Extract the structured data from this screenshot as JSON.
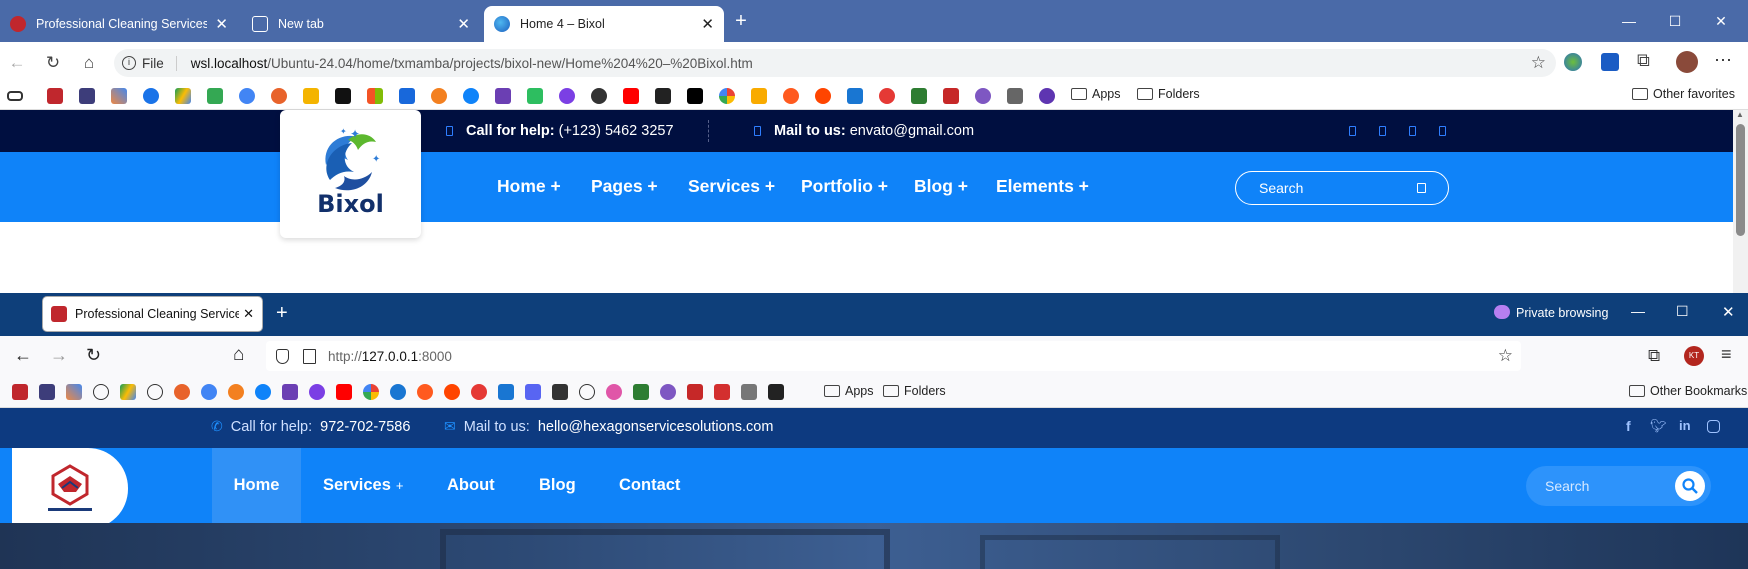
{
  "edge": {
    "tabs": [
      {
        "title": "Professional Cleaning Services - Y",
        "favicon_color": "#c0272d"
      },
      {
        "title": "New tab",
        "favicon_color": "#ffffff"
      },
      {
        "title": "Home 4 – Bixol",
        "favicon_color": "#3a8bd8"
      }
    ],
    "address": {
      "scheme_label": "File",
      "url_host": "wsl.localhost",
      "url_path": "/Ubuntu-24.04/home/txmamba/projects/bixol-new/Home%204%20–%20Bixol.htm"
    },
    "bookmarks": {
      "apps_label": "Apps",
      "folders_label": "Folders",
      "other_label": "Other favorites"
    }
  },
  "bixol": {
    "topbar": {
      "call_label": "Call for help:",
      "call_value": "(+123) 5462 3257",
      "mail_label": "Mail to us:",
      "mail_value": "envato@gmail.com"
    },
    "logo_text": "Bixol",
    "menu": [
      "Home +",
      "Pages +",
      "Services +",
      "Portfolio +",
      "Blog +",
      "Elements +"
    ],
    "search_placeholder": "Search"
  },
  "firefox": {
    "tab_title": "Professional Cleaning Services - Y",
    "private_label": "Private browsing",
    "address": {
      "url_prefix": "http://",
      "url_host": "127.0.0.1",
      "url_port": ":8000"
    },
    "bookmarks": {
      "apps_label": "Apps",
      "folders_label": "Folders",
      "other_label": "Other Bookmarks"
    },
    "avatar_initials": "KT"
  },
  "hexagon": {
    "topbar": {
      "call_label": "Call for help:",
      "call_value": "972-702-7586",
      "mail_label": "Mail to us:",
      "mail_value": "hello@hexagonservicesolutions.com"
    },
    "menu": [
      {
        "label": "Home",
        "active": true
      },
      {
        "label": "Services",
        "suffix": "+"
      },
      {
        "label": "About"
      },
      {
        "label": "Blog"
      },
      {
        "label": "Contact"
      }
    ],
    "search_placeholder": "Search",
    "socials": [
      "facebook-icon",
      "twitter-icon",
      "linkedin-icon",
      "instagram-icon"
    ]
  },
  "colors": {
    "edge_tabbar": "#4a6aa8",
    "bixol_dark": "#000f40",
    "brand_blue": "#0f83f9",
    "hexagon_dark": "#0d3a80",
    "firefox_tabbar": "#0e3f7a"
  }
}
